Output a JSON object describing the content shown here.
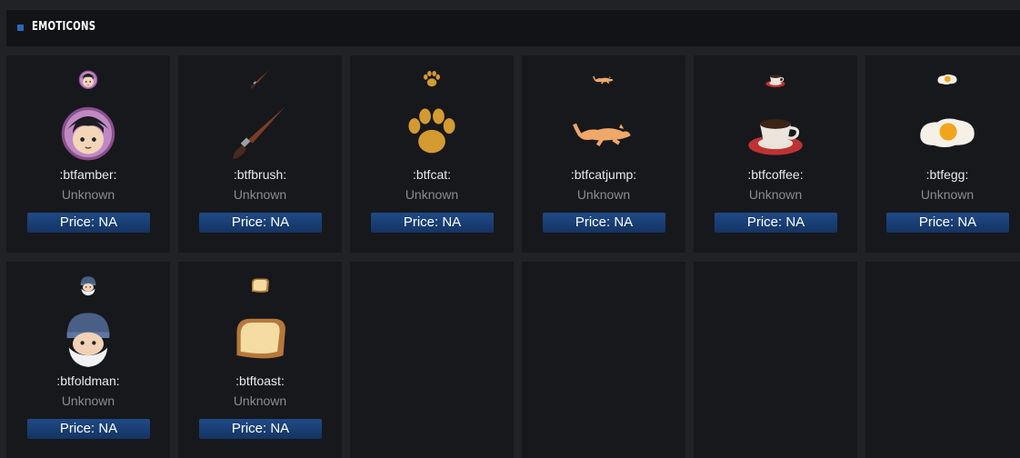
{
  "section": {
    "title": "EMOTICONS",
    "accent": "#2c68b8"
  },
  "emotes": [
    {
      "code": ":btfamber:",
      "status": "Unknown",
      "price": "Price: NA",
      "icon": "amber-face-icon"
    },
    {
      "code": ":btfbrush:",
      "status": "Unknown",
      "price": "Price: NA",
      "icon": "paintbrush-icon"
    },
    {
      "code": ":btfcat:",
      "status": "Unknown",
      "price": "Price: NA",
      "icon": "paw-print-icon"
    },
    {
      "code": ":btfcatjump:",
      "status": "Unknown",
      "price": "Price: NA",
      "icon": "jumping-cat-icon"
    },
    {
      "code": ":btfcoffee:",
      "status": "Unknown",
      "price": "Price: NA",
      "icon": "coffee-cup-icon"
    },
    {
      "code": ":btfegg:",
      "status": "Unknown",
      "price": "Price: NA",
      "icon": "fried-egg-icon"
    },
    {
      "code": ":btfoldman:",
      "status": "Unknown",
      "price": "Price: NA",
      "icon": "old-man-icon"
    },
    {
      "code": ":btftoast:",
      "status": "Unknown",
      "price": "Price: NA",
      "icon": "toast-icon"
    }
  ]
}
